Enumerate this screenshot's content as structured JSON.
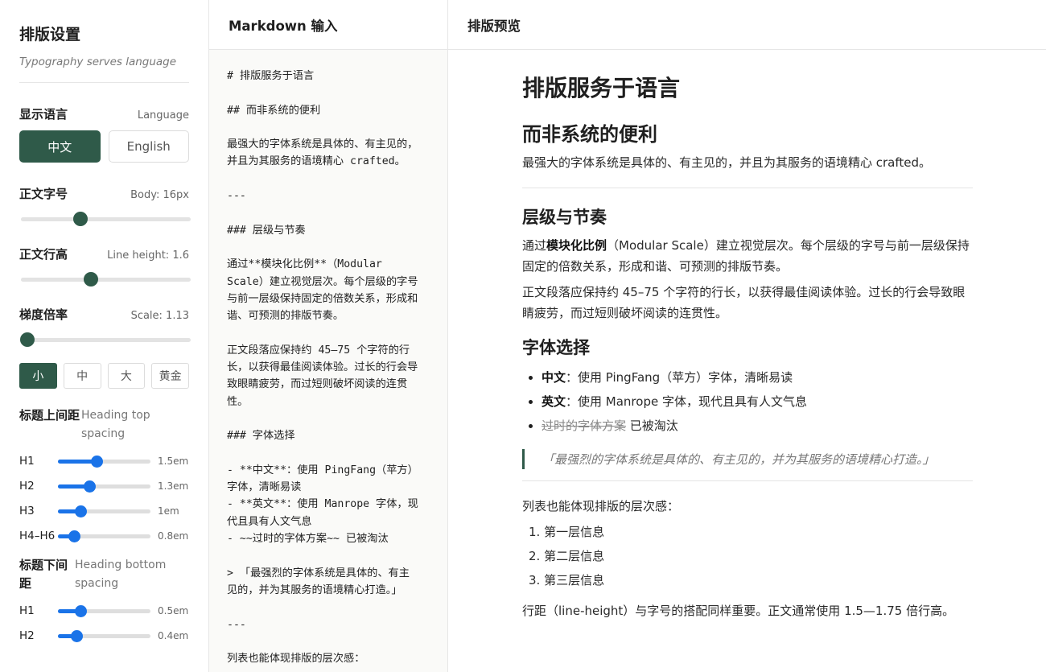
{
  "sidebar": {
    "title": "排版设置",
    "subtitle": "Typography serves language",
    "language": {
      "label": "显示语言",
      "value": "Language",
      "options": [
        "中文",
        "English"
      ],
      "selected": 0
    },
    "body_size": {
      "label": "正文字号",
      "value": "Body: 16px",
      "level": 0.35
    },
    "line_height": {
      "label": "正文行高",
      "value": "Line height: 1.6",
      "level": 0.41
    },
    "scale": {
      "label": "梯度倍率",
      "value": "Scale: 1.13",
      "level": 0.04,
      "options": [
        "小",
        "中",
        "大",
        "黄金"
      ],
      "selected": 0
    },
    "heading_top": {
      "label": "标题上间距",
      "label_en": "Heading top spacing",
      "rows": [
        {
          "tag": "H1",
          "value": "1.5em",
          "level": 0.42
        },
        {
          "tag": "H2",
          "value": "1.3em",
          "level": 0.34
        },
        {
          "tag": "H3",
          "value": "1em",
          "level": 0.24
        },
        {
          "tag": "H4–H6",
          "value": "0.8em",
          "level": 0.17
        }
      ]
    },
    "heading_bottom": {
      "label": "标题下间距",
      "label_en": "Heading bottom spacing",
      "rows": [
        {
          "tag": "H1",
          "value": "0.5em",
          "level": 0.24
        },
        {
          "tag": "H2",
          "value": "0.4em",
          "level": 0.2
        }
      ]
    }
  },
  "editor": {
    "title": "Markdown 输入",
    "lines": [
      "# 排版服务于语言",
      "",
      "## 而非系统的便利",
      "",
      "最强大的字体系统是具体的、有主见的，",
      "并且为其服务的语境精心 crafted。",
      "",
      "---",
      "",
      "### 层级与节奏",
      "",
      "通过**模块化比例**（Modular",
      "Scale）建立视觉层次。每个层级的字号",
      "与前一层级保持固定的倍数关系，形成和",
      "谐、可预测的排版节奏。",
      "",
      "正文段落应保持约 45–75 个字符的行",
      "长，以获得最佳阅读体验。过长的行会导",
      "致眼睛疲劳，而过短则破坏阅读的连贯",
      "性。",
      "",
      "### 字体选择",
      "",
      "- **中文**：使用 PingFang（苹方）",
      "字体，清晰易读",
      "- **英文**：使用 Manrope 字体，现",
      "代且具有人文气息",
      "- ~~过时的字体方案~~ 已被淘汰",
      "",
      "> 「最强烈的字体系统是具体的、有主",
      "见的，并为其服务的语境精心打造。」",
      "",
      "---",
      "",
      "列表也能体现排版的层次感："
    ]
  },
  "preview": {
    "title": "排版预览",
    "h1": "排版服务于语言",
    "h2": "而非系统的便利",
    "p1": "最强大的字体系统是具体的、有主见的，并且为其服务的语境精心 crafted。",
    "h3a": "层级与节奏",
    "p2_pre": "通过",
    "p2_bold": "模块化比例",
    "p2_post": "（Modular Scale）建立视觉层次。每个层级的字号与前一层级保持固定的倍数关系，形成和谐、可预测的排版节奏。",
    "p3": "正文段落应保持约 45–75 个字符的行长，以获得最佳阅读体验。过长的行会导致眼睛疲劳，而过短则破坏阅读的连贯性。",
    "h3b": "字体选择",
    "li1_bold": "中文",
    "li1_text": "：使用 PingFang（苹方）字体，清晰易读",
    "li2_bold": "英文",
    "li2_text": "：使用 Manrope 字体，现代且具有人文气息",
    "li3_strike": "过时的字体方案",
    "li3_text": " 已被淘汰",
    "quote": "「最强烈的字体系统是具体的、有主见的，并为其服务的语境精心打造。」",
    "p4": "列表也能体现排版的层次感：",
    "ol": [
      "1. 第一层信息",
      "2. 第二层信息",
      "3. 第三层信息"
    ],
    "p5": "行距（line-height）与字号的搭配同样重要。正文通常使用 1.5—1.75 倍行高。"
  },
  "colors": {
    "accent": "#2f5a49",
    "mini_slider": "#1a73e8"
  }
}
